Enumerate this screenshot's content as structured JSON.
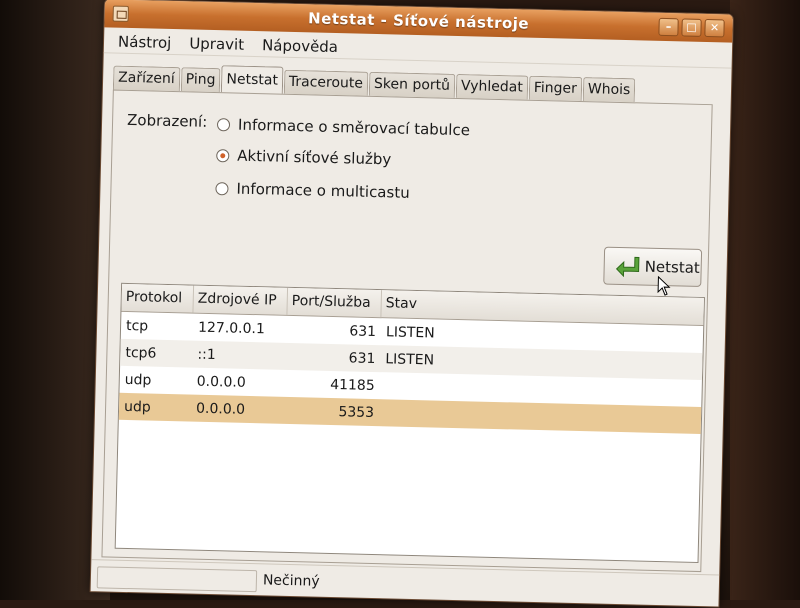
{
  "window": {
    "title": "Netstat - Síťové nástroje",
    "controls": [
      "minimize",
      "maximize",
      "close"
    ]
  },
  "menubar": {
    "items": [
      "Nástroj",
      "Upravit",
      "Nápověda"
    ]
  },
  "tabs": {
    "items": [
      "Zařízení",
      "Ping",
      "Netstat",
      "Traceroute",
      "Sken portů",
      "Vyhledat",
      "Finger",
      "Whois"
    ],
    "active": "Netstat"
  },
  "display": {
    "label": "Zobrazení:",
    "options": [
      {
        "label": "Informace o směrovací tabulce",
        "checked": false
      },
      {
        "label": "Aktivní síťové služby",
        "checked": true
      },
      {
        "label": "Informace o multicastu",
        "checked": false
      }
    ]
  },
  "netstat_button": {
    "label": "Netstat",
    "icon": "enter-arrow-icon"
  },
  "table": {
    "columns": [
      "Protokol",
      "Zdrojové IP",
      "Port/Služba",
      "Stav"
    ],
    "rows": [
      {
        "protocol": "tcp",
        "ip": "127.0.0.1",
        "port": "631",
        "state": "LISTEN"
      },
      {
        "protocol": "tcp6",
        "ip": "::1",
        "port": "631",
        "state": "LISTEN"
      },
      {
        "protocol": "udp",
        "ip": "0.0.0.0",
        "port": "41185",
        "state": ""
      },
      {
        "protocol": "udp",
        "ip": "0.0.0.0",
        "port": "5353",
        "state": ""
      }
    ],
    "selected_row": 3
  },
  "statusbar": {
    "text": "Nečinný"
  },
  "colors": {
    "titlebar": "#c8702e",
    "selection": "#e9c996",
    "radio_dot": "#d0622a"
  }
}
